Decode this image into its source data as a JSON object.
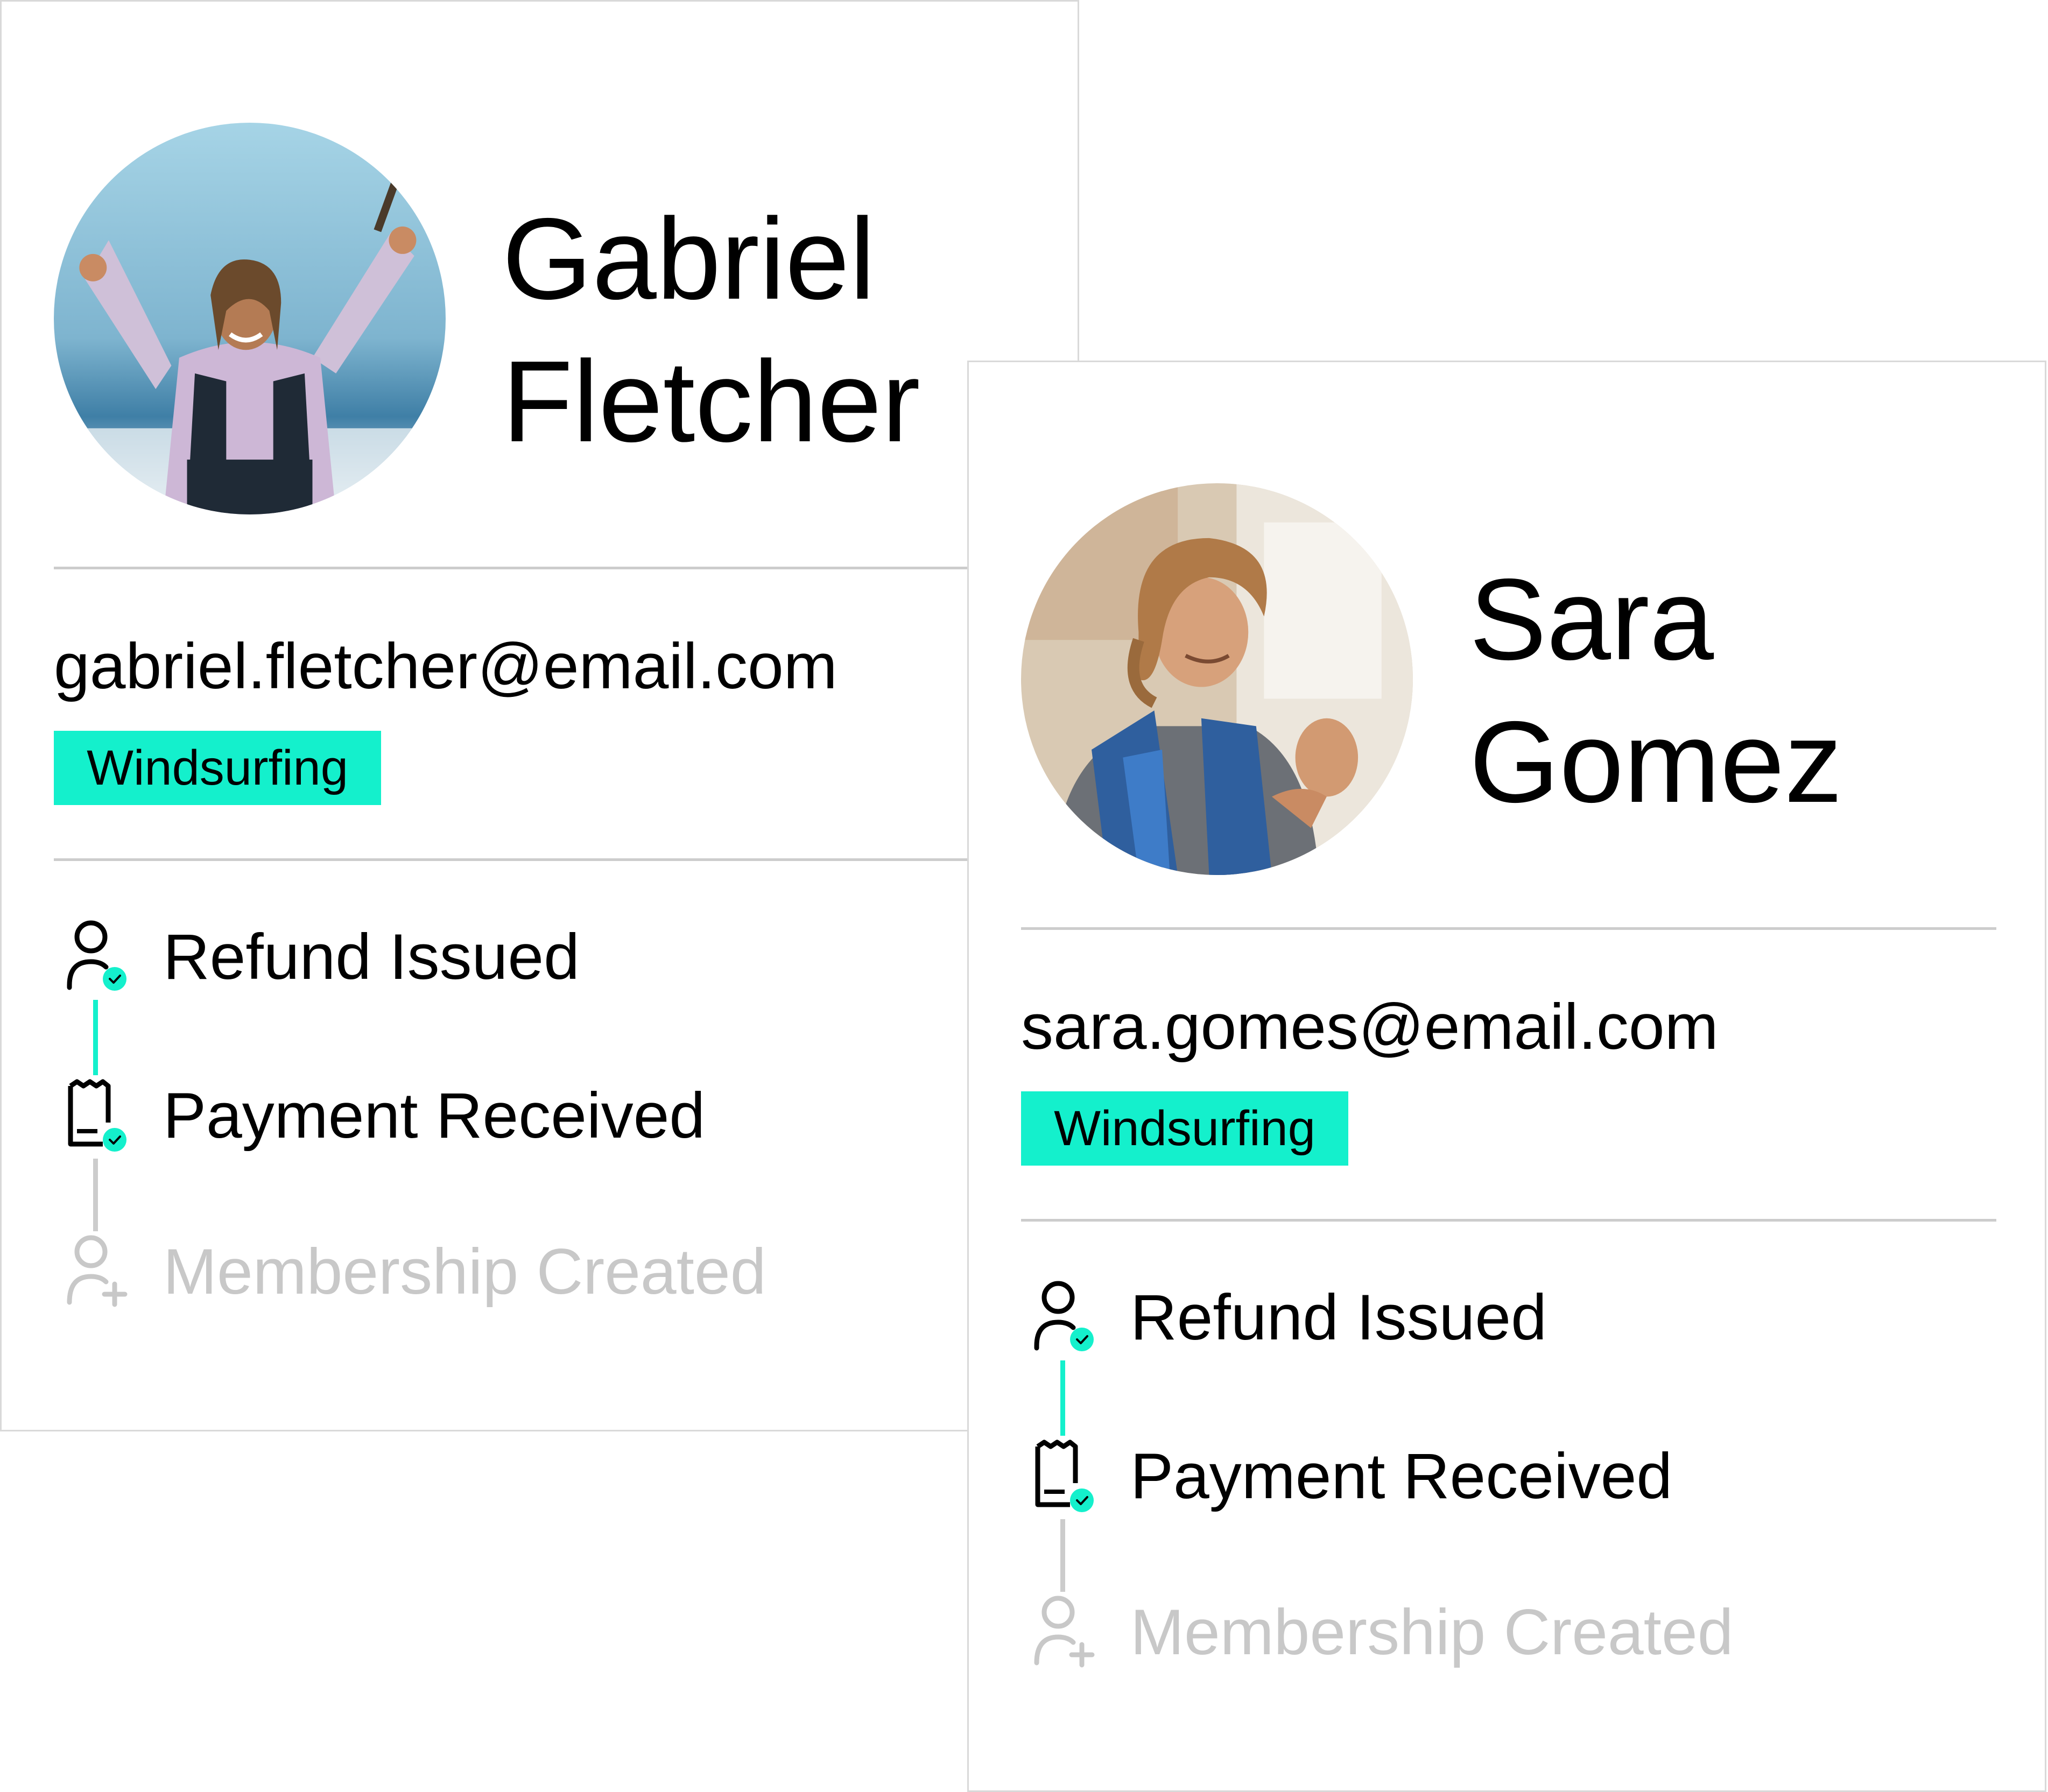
{
  "theme": {
    "accent": "#14f0cc",
    "divider": "#cccccc",
    "muted_text": "#c8c8c8",
    "border": "#d9d9d9"
  },
  "cards": [
    {
      "avatar_icon": "avatar-photo-man-kitesurfer",
      "name_first": "Gabriel",
      "name_last": "Fletcher",
      "email": "gabriel.fletcher@email.com",
      "tag": "Windsurfing",
      "timeline": [
        {
          "label": "Refund Issued",
          "icon": "user-check-icon",
          "state": "done"
        },
        {
          "label": "Payment Received",
          "icon": "receipt-check-icon",
          "state": "done"
        },
        {
          "label": "Membership Created",
          "icon": "user-plus-icon",
          "state": "pending"
        }
      ]
    },
    {
      "avatar_icon": "avatar-photo-woman-sailor",
      "name_first": "Sara",
      "name_last": "Gomez",
      "email": "sara.gomes@email.com",
      "tag": "Windsurfing",
      "timeline": [
        {
          "label": "Refund Issued",
          "icon": "user-check-icon",
          "state": "done"
        },
        {
          "label": "Payment Received",
          "icon": "receipt-check-icon",
          "state": "done"
        },
        {
          "label": "Membership Created",
          "icon": "user-plus-icon",
          "state": "pending"
        }
      ]
    }
  ]
}
